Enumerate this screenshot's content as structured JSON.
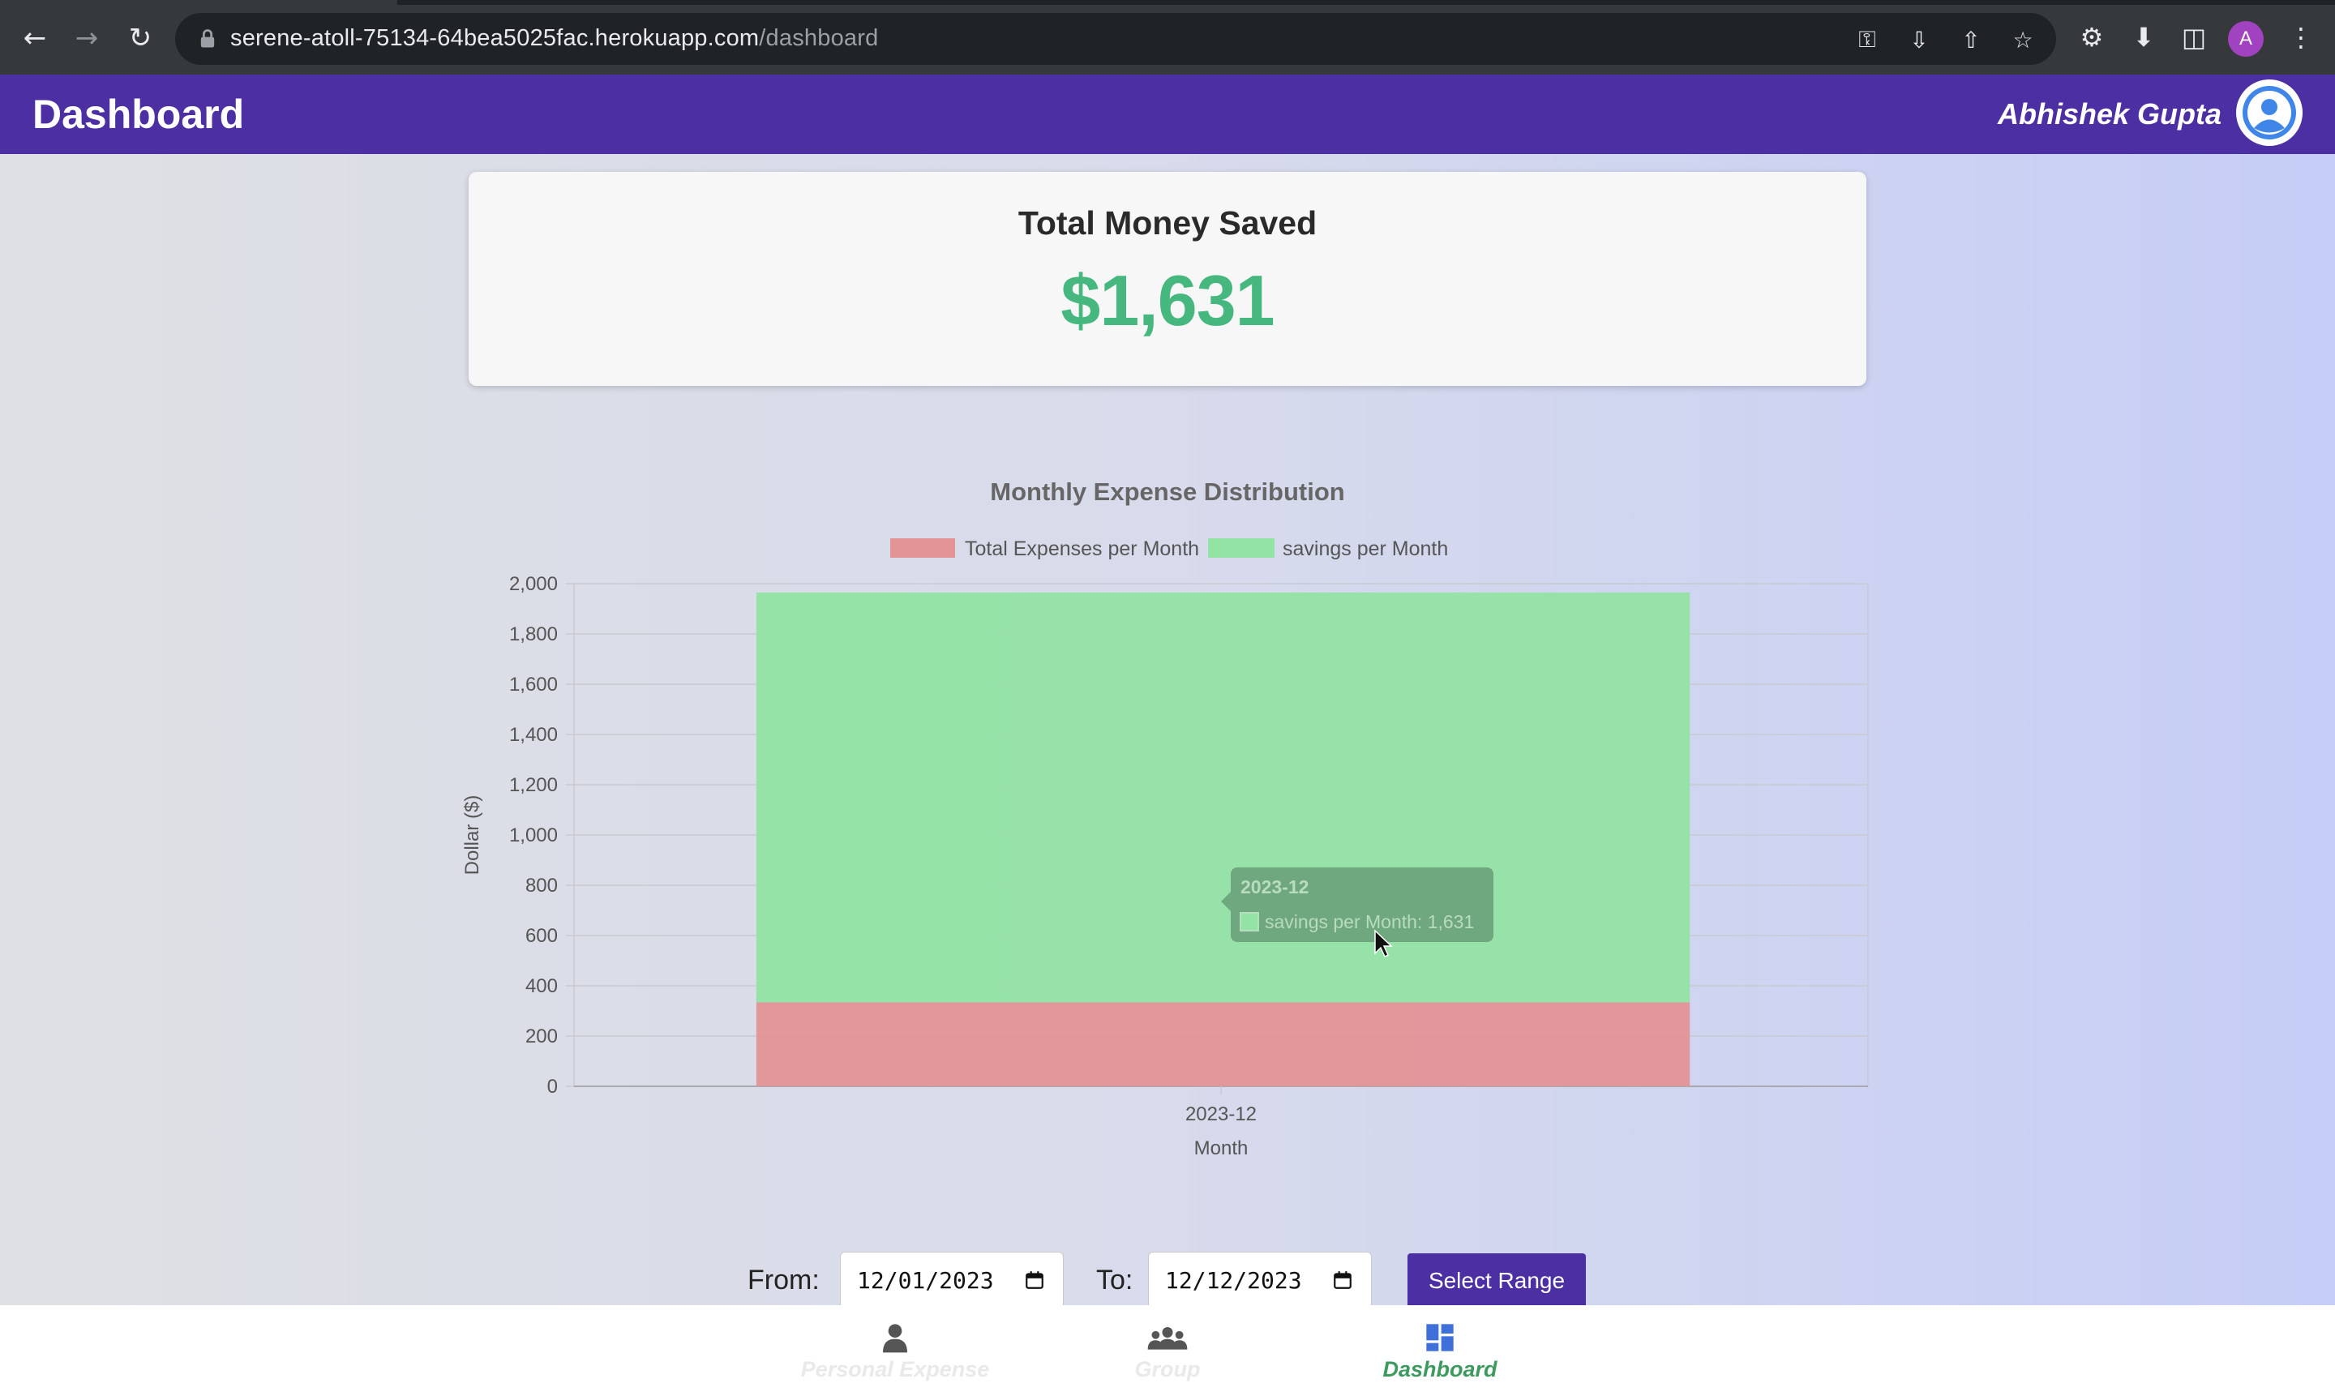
{
  "browser": {
    "url_host": "serene-atoll-75134-64bea5025fac.herokuapp.com",
    "url_path": "/dashboard",
    "profile_initial": "A"
  },
  "header": {
    "title": "Dashboard",
    "user_name": "Abhishek Gupta"
  },
  "summary": {
    "title": "Total Money Saved",
    "amount": "$1,631"
  },
  "chart_data": {
    "type": "bar",
    "stacked": true,
    "title": "Monthly Expense Distribution",
    "xlabel": "Month",
    "ylabel": "Dollar ($)",
    "categories": [
      "2023-12"
    ],
    "ylim": [
      0,
      2000
    ],
    "yticks": [
      "0",
      "200",
      "400",
      "600",
      "800",
      "1,000",
      "1,200",
      "1,400",
      "1,600",
      "1,800",
      "2,000"
    ],
    "legend_position": "top",
    "grid": true,
    "series": [
      {
        "name": "Total Expenses per Month",
        "values": [
          334
        ],
        "color": "#e39497"
      },
      {
        "name": "savings per Month",
        "values": [
          1631
        ],
        "color": "#92e3a4"
      }
    ],
    "tooltip": {
      "title": "2023-12",
      "text": "savings per Month: 1,631"
    }
  },
  "range": {
    "from_label": "From:",
    "from_value": "12/01/2023",
    "to_label": "To:",
    "to_value": "12/12/2023",
    "button_label": "Select Range"
  },
  "bottom_nav": {
    "items": [
      {
        "label": "Personal Expense",
        "icon": "person-icon"
      },
      {
        "label": "Group",
        "icon": "group-icon"
      },
      {
        "label": "Dashboard",
        "icon": "dashboard-icon"
      }
    ]
  }
}
